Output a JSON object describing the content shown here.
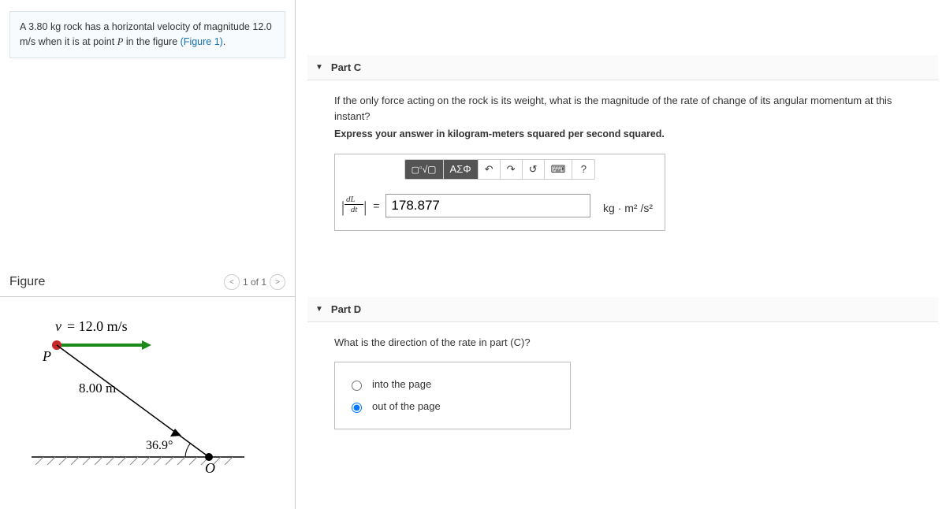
{
  "problem": {
    "mass": "3.80",
    "mass_unit": "kg",
    "text1": "rock has a horizontal velocity of magnitude",
    "speed": "12.0",
    "speed_unit": "m/s",
    "text2": "when it is at point",
    "point": "P",
    "text3": "in the figure",
    "figlink": "(Figure 1)"
  },
  "figureHead": {
    "title": "Figure",
    "pager": "1 of 1"
  },
  "figureDiagram": {
    "velocity_label": "v = 12.0 m/s",
    "point_label": "P",
    "distance_label": "8.00 m",
    "angle_label": "36.9°",
    "origin_label": "O"
  },
  "partC": {
    "title": "Part C",
    "prompt": "If the only force acting on the rock is its weight, what is the magnitude of the rate of change of its angular momentum at this instant?",
    "instruct": "Express your answer in kilogram-meters squared per second squared.",
    "toolbar": {
      "templates": "▢√▢",
      "greek": "ΑΣΦ",
      "undo": "↶",
      "redo": "↷",
      "reset": "↺",
      "keyboard": "⌨",
      "help": "?"
    },
    "var_num": "dL⃗",
    "var_den": "dt",
    "equals": "=",
    "answer": "178.877",
    "units": "kg · m² /s²"
  },
  "partD": {
    "title": "Part D",
    "prompt": "What is the direction of the rate in part (C)?",
    "options": {
      "a": "into the page",
      "b": "out of the page"
    },
    "selected": "b"
  }
}
